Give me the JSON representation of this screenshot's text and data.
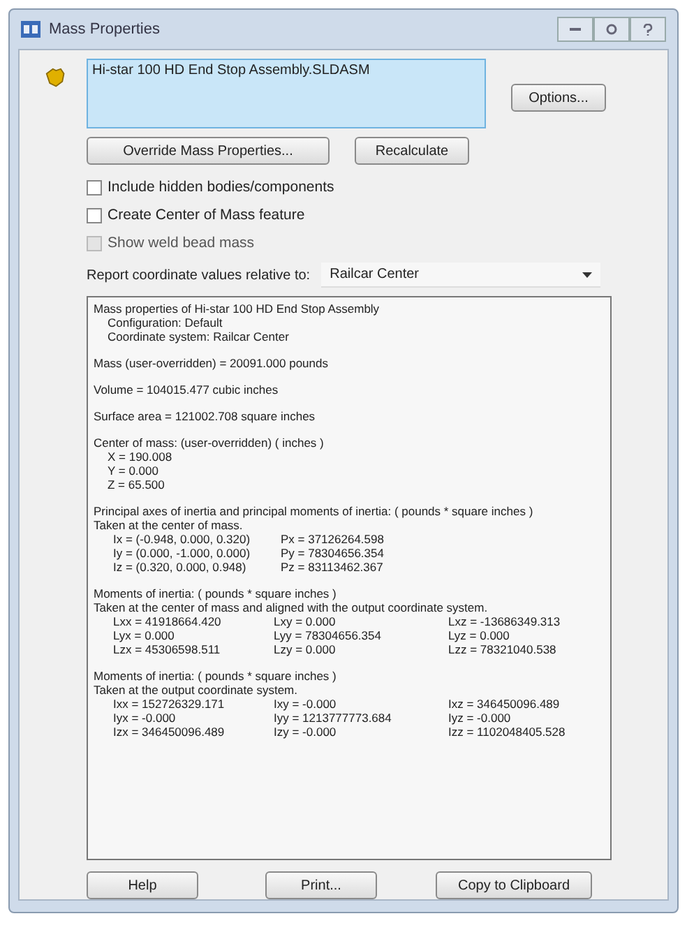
{
  "window": {
    "title": "Mass Properties"
  },
  "selection": {
    "items": [
      "Hi-star 100 HD End Stop Assembly.SLDASM"
    ]
  },
  "buttons_top": {
    "options": "Options...",
    "override": "Override Mass Properties...",
    "recalculate": "Recalculate"
  },
  "checkboxes": [
    {
      "label": "Include hidden bodies/components",
      "checked": false,
      "disabled": false
    },
    {
      "label": "Create Center of Mass feature",
      "checked": false,
      "disabled": false
    },
    {
      "label": "Show weld bead mass",
      "checked": false,
      "disabled": true
    }
  ],
  "report": {
    "label": "Report coordinate values relative to:",
    "value": "Railcar Center"
  },
  "results": [
    {
      "lines": [
        {
          "text": "Mass properties of Hi-star 100 HD End Stop Assembly",
          "indent": false
        },
        {
          "text": "Configuration: Default",
          "indent": true
        },
        {
          "text": "Coordinate system: Railcar Center",
          "indent": true
        }
      ]
    },
    {
      "lines": [
        {
          "text": "Mass (user-overridden) = 20091.000 pounds",
          "indent": false
        }
      ]
    },
    {
      "lines": [
        {
          "text": "Volume = 104015.477 cubic inches",
          "indent": false
        }
      ]
    },
    {
      "lines": [
        {
          "text": "Surface area = 121002.708 square inches",
          "indent": false
        }
      ]
    },
    {
      "lines": [
        {
          "text": "Center of mass: (user-overridden) ( inches )",
          "indent": false
        },
        {
          "text": "X = 190.008",
          "indent": true
        },
        {
          "text": "Y = 0.000",
          "indent": true
        },
        {
          "text": "Z = 65.500",
          "indent": true
        }
      ]
    },
    {
      "lines": [
        {
          "text": "Principal axes of inertia and principal moments of inertia: ( pounds * square inches )",
          "indent": false
        },
        {
          "text": "Taken at the center of mass.",
          "indent": false
        }
      ],
      "rows": [
        [
          "Ix = (-0.948, 0.000, 0.320)",
          "Px = 37126264.598"
        ],
        [
          "Iy = (0.000, -1.000, 0.000)",
          "Py = 78304656.354"
        ],
        [
          "Iz = (0.320, 0.000, 0.948)",
          "Pz = 83113462.367"
        ]
      ]
    },
    {
      "lines": [
        {
          "text": "Moments of inertia: ( pounds * square inches )",
          "indent": false
        },
        {
          "text": "Taken at the center of mass and aligned with the output coordinate system.",
          "indent": false
        }
      ],
      "rows": [
        [
          "Lxx = 41918664.420",
          "Lxy = 0.000",
          "Lxz = -13686349.313"
        ],
        [
          "Lyx = 0.000",
          "Lyy = 78304656.354",
          "Lyz = 0.000"
        ],
        [
          "Lzx = 45306598.511",
          "Lzy = 0.000",
          "Lzz = 78321040.538"
        ]
      ]
    },
    {
      "lines": [
        {
          "text": "Moments of inertia: ( pounds * square inches )",
          "indent": false
        },
        {
          "text": "Taken at the output coordinate system.",
          "indent": false
        }
      ],
      "rows": [
        [
          "Ixx = 152726329.171",
          "Ixy = -0.000",
          "Ixz = 346450096.489"
        ],
        [
          "Iyx = -0.000",
          "Iyy = 1213777773.684",
          "Iyz = -0.000"
        ],
        [
          "Izx = 346450096.489",
          "Izy = -0.000",
          "Izz = 1102048405.528"
        ]
      ]
    }
  ],
  "buttons_bottom": [
    "Help",
    "Print...",
    "Copy to Clipboard"
  ]
}
